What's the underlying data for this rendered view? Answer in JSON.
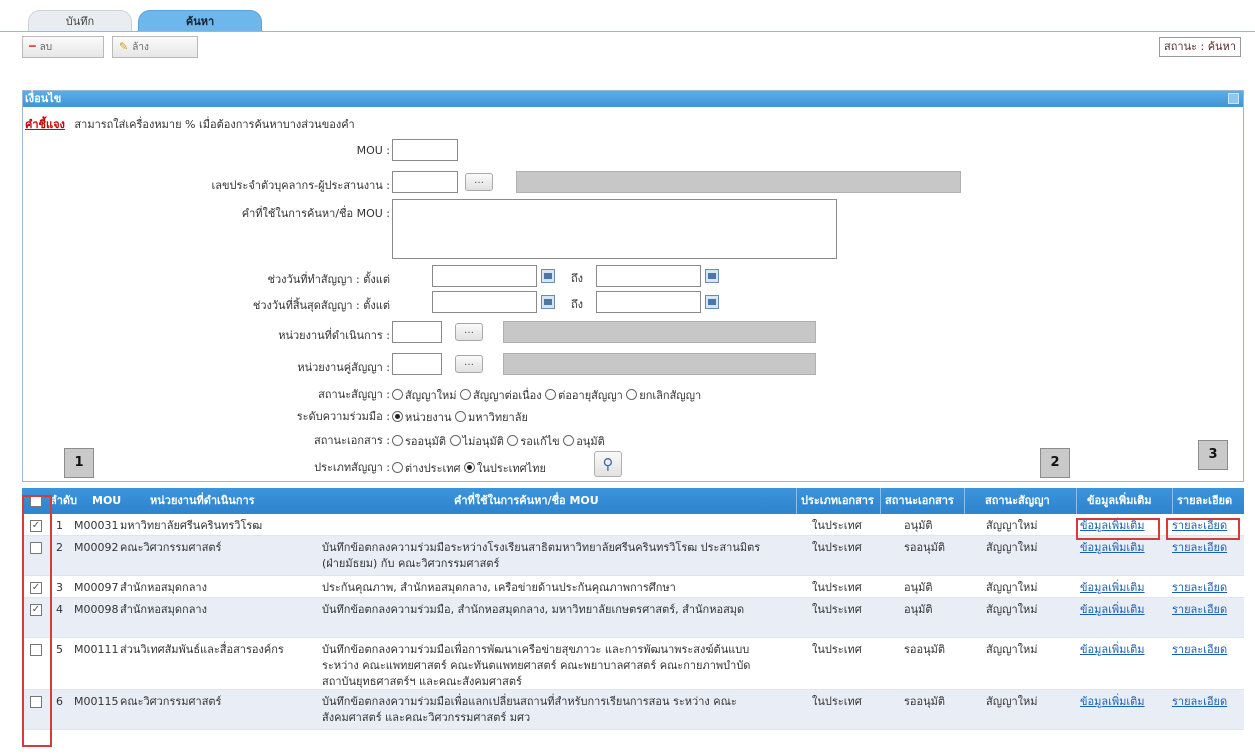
{
  "tabs": [
    "บันทึก",
    "ค้นหา"
  ],
  "toolbar": {
    "delete_label": "ลบ",
    "clear_label": "ล้าง",
    "status": "สถานะ : ค้นหา"
  },
  "panel": {
    "title": "เงื่อนไข",
    "note_label": "คำชี้แจง",
    "note_text": "สามารถใส่เครื่องหมาย % เมื่อต้องการค้นหาบางส่วนของคำ",
    "fields": {
      "mou": "MOU :",
      "person": "เลขประจำตัวบุคลากร-ผู้ประสานงาน :",
      "keyword": "คำที่ใช้ในการค้นหา/ชื่อ MOU :",
      "sign_date": "ช่วงวันที่ทำสัญญา :",
      "end_date": "ช่วงวันที่สิ้นสุดสัญญา :",
      "from": "ตั้งแต่",
      "to": "ถึง",
      "unit": "หน่วยงานที่ดำเนินการ :",
      "partner": "หน่วยงานคู่สัญญา :",
      "contract_status": "สถานะสัญญา :",
      "level": "ระดับความร่วมมือ :",
      "doc_status": "สถานะเอกสาร :",
      "contract_type": "ประเภทสัญญา :"
    },
    "contract_status_options": [
      "สัญญาใหม่",
      "สัญญาต่อเนื่อง",
      "ต่ออายุสัญญา",
      "ยกเลิกสัญญา"
    ],
    "level_options": [
      "หน่วยงาน",
      "มหาวิทยาลัย"
    ],
    "doc_status_options": [
      "รออนุมัติ",
      "ไม่อนุมัติ",
      "รอแก้ไข",
      "อนุมัติ"
    ],
    "contract_type_options": [
      "ต่างประเทศ",
      "ในประเทศไทย"
    ]
  },
  "callouts": [
    "1",
    "2",
    "3"
  ],
  "table": {
    "headers": [
      "ลำดับ",
      "MOU",
      "หน่วยงานที่ดำเนินการ",
      "คำที่ใช้ในการค้นหา/ชื่อ MOU",
      "ประเภทเอกสาร",
      "สถานะเอกสาร",
      "สถานะสัญญา",
      "ข้อมูลเพิ่มเติม",
      "รายละเอียด"
    ],
    "rows": [
      {
        "no": "1",
        "mou": "M00031",
        "unit": "มหาวิทยาลัยศรีนครินทรวิโรฒ",
        "title": "",
        "type": "ในประเทศ",
        "doc": "อนุมัติ",
        "contract": "สัญญาใหม่",
        "more": "ข้อมูลเพิ่มเติม",
        "detail": "รายละเอียด",
        "checked": true
      },
      {
        "no": "2",
        "mou": "M00092",
        "unit": "คณะวิศวกรรมศาสตร์",
        "title": "บันทึกข้อตกลงความร่วมมือระหว่างโรงเรียนสาธิตมหาวิทยาลัยศรีนครินทรวิโรฒ ประสานมิตร (ฝ่ายมัธยม) กับ คณะวิศวกรรมศาสตร์",
        "type": "ในประเทศ",
        "doc": "รออนุมัติ",
        "contract": "สัญญาใหม่",
        "more": "ข้อมูลเพิ่มเติม",
        "detail": "รายละเอียด",
        "checked": false
      },
      {
        "no": "3",
        "mou": "M00097",
        "unit": "สำนักหอสมุดกลาง",
        "title": "ประกันคุณภาพ, สำนักหอสมุดกลาง, เครือข่ายด้านประกันคุณภาพการศึกษา",
        "type": "ในประเทศ",
        "doc": "อนุมัติ",
        "contract": "สัญญาใหม่",
        "more": "ข้อมูลเพิ่มเติม",
        "detail": "รายละเอียด",
        "checked": true
      },
      {
        "no": "4",
        "mou": "M00098",
        "unit": "สำนักหอสมุดกลาง",
        "title": "บันทึกข้อตกลงความร่วมมือ, สำนักหอสมุดกลาง, มหาวิทยาลัยเกษตรศาสตร์, สำนักหอสมุด",
        "type": "ในประเทศ",
        "doc": "อนุมัติ",
        "contract": "สัญญาใหม่",
        "more": "ข้อมูลเพิ่มเติม",
        "detail": "รายละเอียด",
        "checked": true
      },
      {
        "no": "5",
        "mou": "M00111",
        "unit": "ส่วนวิเทศสัมพันธ์และสื่อสารองค์กร",
        "title": "บันทึกข้อตกลงความร่วมมือเพื่อการพัฒนาเครือข่ายสุขภาวะ และการพัฒนาพระสงฆ์ต้นแบบ ระหว่าง คณะแพทยศาสตร์ คณะทันตแพทยศาสตร์ คณะพยาบาลศาสตร์ คณะกายภาพบำบัด สถาบันยุทธศาสตร์ฯ และคณะสังคมศาสตร์",
        "type": "ในประเทศ",
        "doc": "รออนุมัติ",
        "contract": "สัญญาใหม่",
        "more": "ข้อมูลเพิ่มเติม",
        "detail": "รายละเอียด",
        "checked": false
      },
      {
        "no": "6",
        "mou": "M00115",
        "unit": "คณะวิศวกรรมศาสตร์",
        "title": "บันทึกข้อตกลงความร่วมมือเพื่อแลกเปลี่ยนสถานที่สำหรับการเรียนการสอน ระหว่าง คณะสังคมศาสตร์ และคณะวิศวกรรมศาสตร์ มศว",
        "type": "ในประเทศ",
        "doc": "รออนุมัติ",
        "contract": "สัญญาใหม่",
        "more": "ข้อมูลเพิ่มเติม",
        "detail": "รายละเอียด",
        "checked": false
      }
    ]
  },
  "colors": {
    "header_blue": "#3b94dc",
    "link": "#1a5fb4",
    "highlight_red": "#d43b3b",
    "panel_blue": "#4a9fe0"
  }
}
